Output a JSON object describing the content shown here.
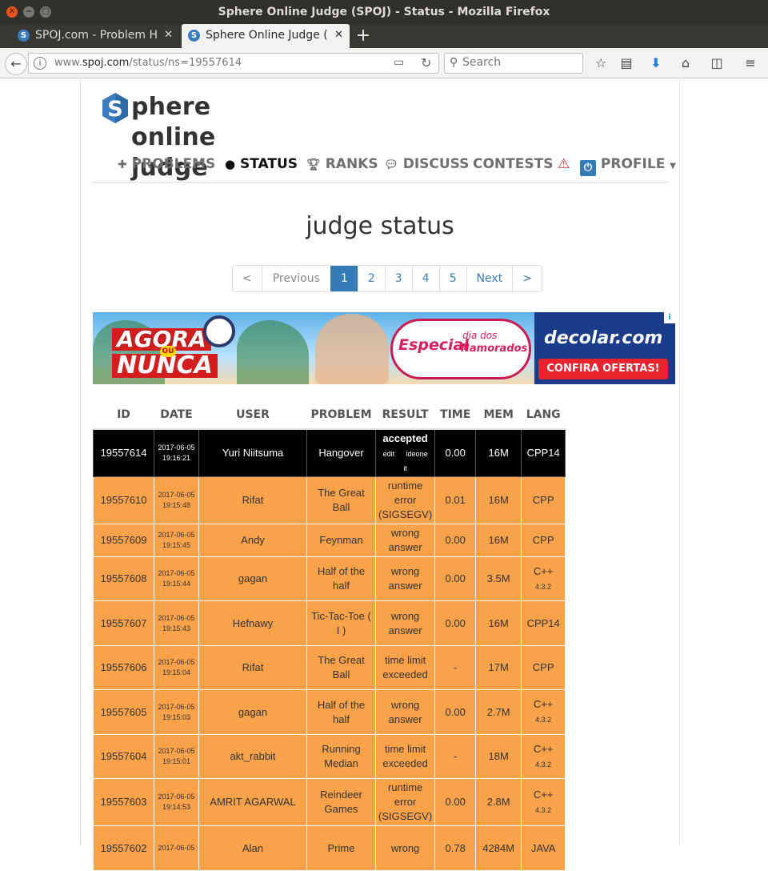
{
  "browser": {
    "window_title": "Sphere Online Judge (SPOJ) - Status - Mozilla Firefox",
    "tabs": [
      {
        "label": "SPOJ.com - Problem H",
        "active": false
      },
      {
        "label": "Sphere Online Judge (",
        "active": true
      }
    ],
    "url_host_prefix": "www.",
    "url_host": "spoj.com",
    "url_path": "/status/ns=19557614",
    "search_placeholder": "Search"
  },
  "site": {
    "logo_letter": "S",
    "logo_text": "phere online judge",
    "nav": [
      {
        "label": "PROBLEMS",
        "icon": "puzzle-icon"
      },
      {
        "label": "STATUS",
        "icon": "circle-icon"
      },
      {
        "label": "RANKS",
        "icon": "trophy-icon"
      },
      {
        "label": "DISCUSS",
        "icon": "comments-icon"
      },
      {
        "label": "CONTESTS",
        "icon": ""
      },
      {
        "label": "",
        "icon": "warning-icon"
      },
      {
        "label": "PROFILE",
        "icon": "power-icon"
      }
    ]
  },
  "main": {
    "title": "judge status",
    "pagination": [
      "<",
      "Previous",
      "1",
      "2",
      "3",
      "4",
      "5",
      "Next",
      ">"
    ],
    "pagination_active": "1"
  },
  "ad": {
    "agora": "AGORA",
    "ou": "OU",
    "nunca": "NUNCA",
    "especial": "Especial",
    "dia_dos": "dia dos",
    "namorados": "Namorados",
    "brand": "decolar.com",
    "cta": "CONFIRA OFERTAS!"
  },
  "table": {
    "headers": [
      "ID",
      "DATE",
      "USER",
      "PROBLEM",
      "RESULT",
      "TIME",
      "MEM",
      "LANG"
    ],
    "rows": [
      {
        "id": "19557614",
        "date": "2017-06-05",
        "time_of_day": "19:16:21",
        "user": "Yuri Niitsuma",
        "problem": "Hangover",
        "result": "accepted",
        "result_links": [
          "edit",
          "ideone",
          "it"
        ],
        "time": "0.00",
        "mem": "16M",
        "lang": "CPP14",
        "lang_ver": "",
        "accepted": true
      },
      {
        "id": "19557610",
        "date": "2017-06-05",
        "time_of_day": "19:15:48",
        "user": "Rifat",
        "problem": "The Great Ball",
        "result": "runtime error (SIGSEGV)",
        "time": "0.01",
        "mem": "16M",
        "lang": "CPP",
        "lang_ver": ""
      },
      {
        "id": "19557609",
        "date": "2017-06-05",
        "time_of_day": "19:15:45",
        "user": "Andy",
        "problem": "Feynman",
        "result": "wrong answer",
        "time": "0.00",
        "mem": "16M",
        "lang": "CPP",
        "lang_ver": ""
      },
      {
        "id": "19557608",
        "date": "2017-06-05",
        "time_of_day": "19:15:44",
        "user": "gagan",
        "problem": "Half of the half",
        "result": "wrong answer",
        "time": "0.00",
        "mem": "3.5M",
        "lang": "C++",
        "lang_ver": "4.3.2"
      },
      {
        "id": "19557607",
        "date": "2017-06-05",
        "time_of_day": "19:15:43",
        "user": "Hefnawy",
        "problem": "Tic-Tac-Toe ( I )",
        "result": "wrong answer",
        "time": "0.00",
        "mem": "16M",
        "lang": "CPP14",
        "lang_ver": ""
      },
      {
        "id": "19557606",
        "date": "2017-06-05",
        "time_of_day": "19:15:04",
        "user": "Rifat",
        "problem": "The Great Ball",
        "result": "time limit exceeded",
        "time": "-",
        "mem": "17M",
        "lang": "CPP",
        "lang_ver": ""
      },
      {
        "id": "19557605",
        "date": "2017-06-05",
        "time_of_day": "19:15:03",
        "user": "gagan",
        "problem": "Half of the half",
        "result": "wrong answer",
        "time": "0.00",
        "mem": "2.7M",
        "lang": "C++",
        "lang_ver": "4.3.2"
      },
      {
        "id": "19557604",
        "date": "2017-06-05",
        "time_of_day": "19:15:01",
        "user": "akt_rabbit",
        "problem": "Running Median",
        "result": "time limit exceeded",
        "time": "-",
        "mem": "18M",
        "lang": "C++",
        "lang_ver": "4.3.2"
      },
      {
        "id": "19557603",
        "date": "2017-06-05",
        "time_of_day": "19:14:53",
        "user": "AMRIT AGARWAL",
        "problem": "Reindeer Games",
        "result": "runtime error (SIGSEGV)",
        "time": "0.00",
        "mem": "2.8M",
        "lang": "C++",
        "lang_ver": "4.3.2"
      },
      {
        "id": "19557602",
        "date": "2017-06-05",
        "time_of_day": "",
        "user": "Alan",
        "problem": "Prime",
        "result": "wrong",
        "time": "0.78",
        "mem": "4284M",
        "lang": "JAVA",
        "lang_ver": ""
      }
    ]
  }
}
